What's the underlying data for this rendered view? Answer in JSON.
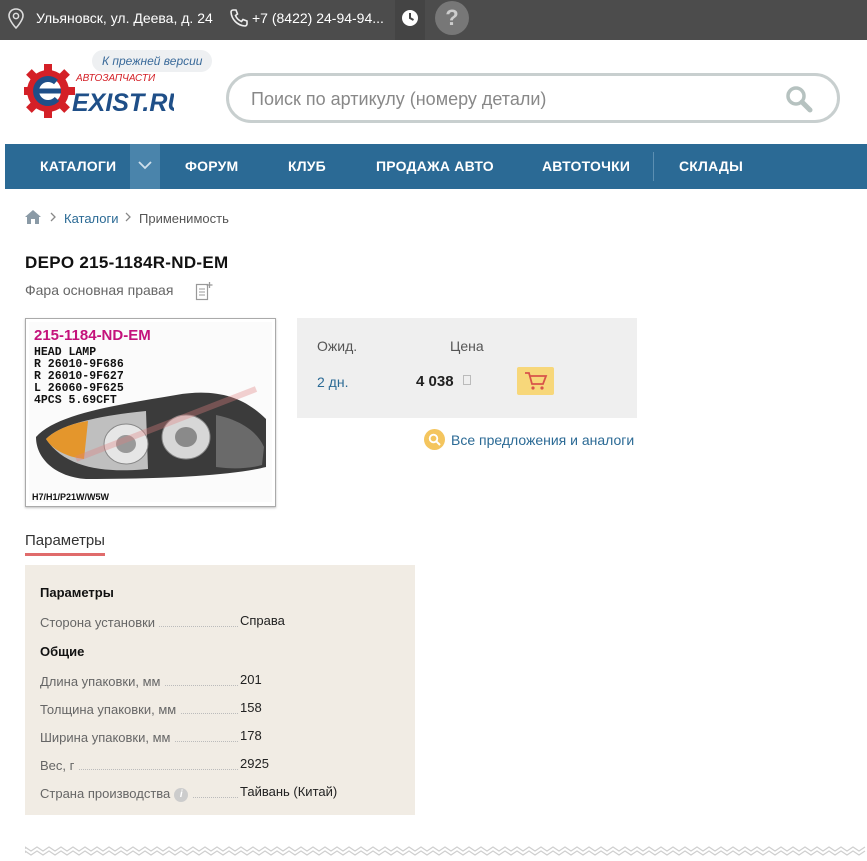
{
  "topbar": {
    "address": "Ульяновск, ул. Деева, д. 24",
    "phone": "+7 (8422) 24-94-94...",
    "help": "?"
  },
  "logo": {
    "tagline": "АВТОЗАПЧАСТИ",
    "brand": "EXIST.RU"
  },
  "prev_version": "К прежней версии",
  "search": {
    "placeholder": "Поиск по артикулу (номеру детали)"
  },
  "nav": {
    "items": [
      "КАТАЛОГИ",
      "ФОРУМ",
      "КЛУБ",
      "ПРОДАЖА АВТО",
      "АВТОТОЧКИ",
      "СКЛАДЫ"
    ]
  },
  "breadcrumb": [
    "Каталоги",
    "Применимость"
  ],
  "product": {
    "title": "DEPO 215-1184R-ND-EM",
    "subtitle": "Фара основная правая",
    "photo_label": {
      "code": "215-1184-ND-EM",
      "lines": [
        "HEAD LAMP",
        "R  26010-9F686",
        "R  26010-9F627",
        "L  26060-9F625",
        "4PCS  5.69CFT"
      ],
      "bulbs": "H7/H1/P21W/W5W"
    }
  },
  "offer": {
    "wait_header": "Ожид.",
    "price_header": "Цена",
    "wait": "2 дн.",
    "price": "4 038"
  },
  "all_offers": "Все предложения и аналоги",
  "params_tab": "Параметры",
  "params": {
    "sections": [
      {
        "title": "Параметры",
        "rows": [
          {
            "key": "Сторона установки",
            "value": "Справа"
          }
        ]
      },
      {
        "title": "Общие",
        "rows": [
          {
            "key": "Длина упаковки, мм",
            "value": "201"
          },
          {
            "key": "Толщина упаковки, мм",
            "value": "158"
          },
          {
            "key": "Ширина упаковки, мм",
            "value": "178"
          },
          {
            "key": "Вес, г",
            "value": "2925"
          },
          {
            "key": "Страна производства",
            "value": "Тайвань (Китай)",
            "info": "i"
          }
        ]
      }
    ]
  },
  "colors": {
    "nav": "#2b6a95",
    "topbar": "#4c4c4c",
    "accent": "#f4c55e",
    "tab_underline": "#e06b6b"
  }
}
